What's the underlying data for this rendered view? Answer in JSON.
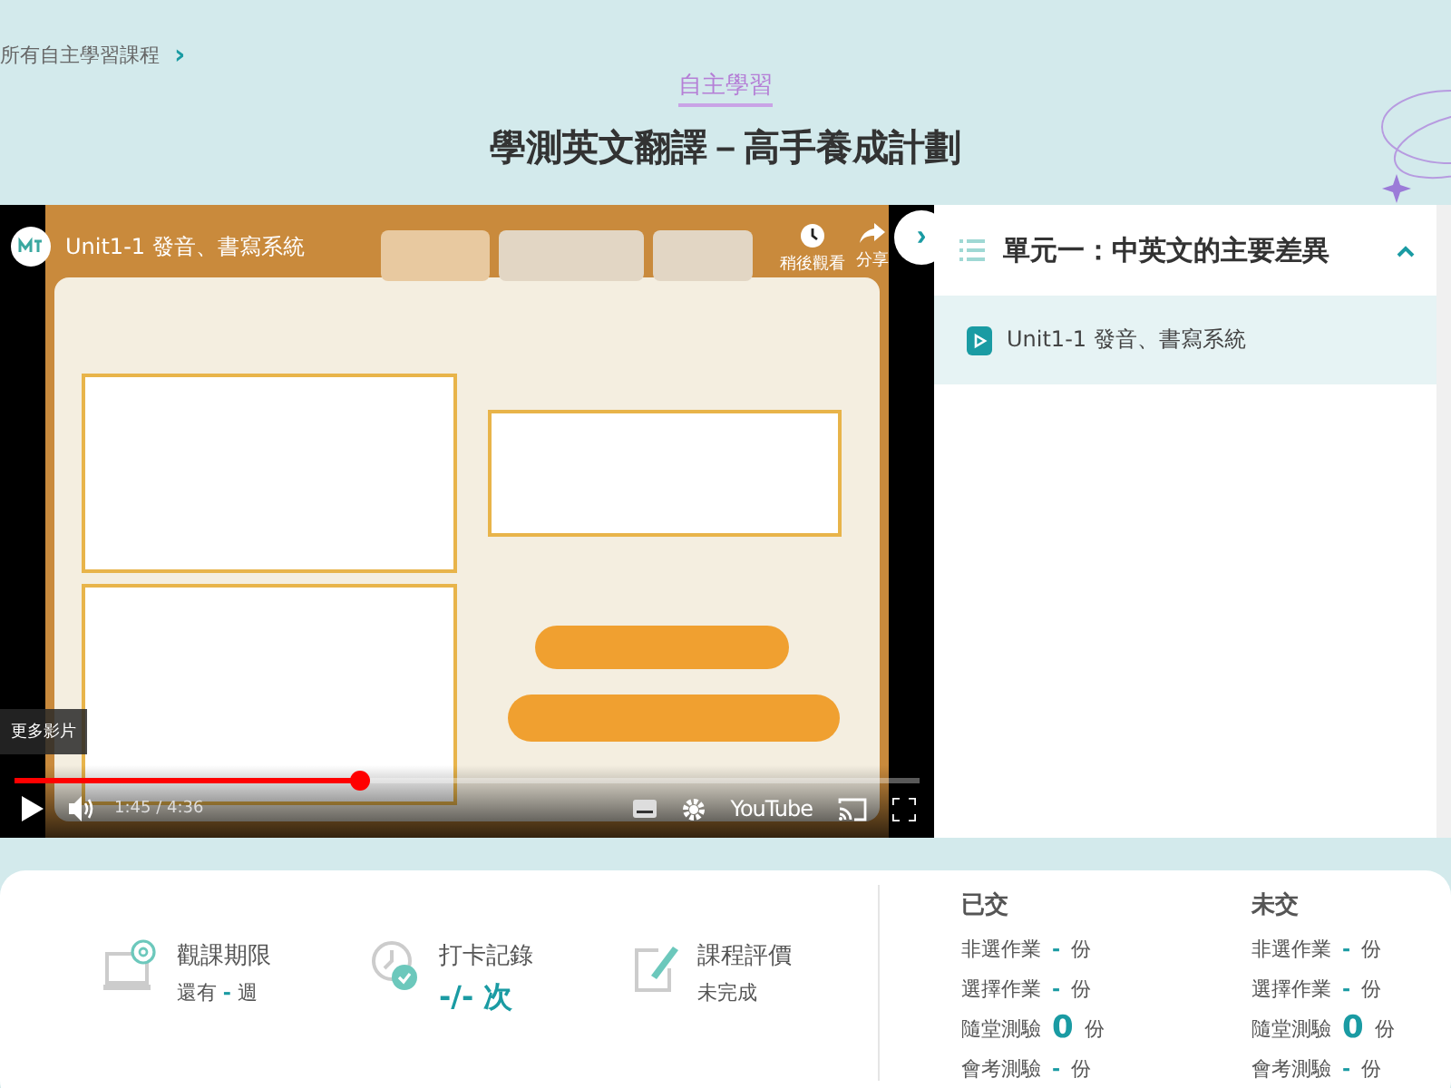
{
  "breadcrumb": {
    "label": "所有自主學習課程",
    "chevron": "›"
  },
  "category": "自主學習",
  "title": "學測英文翻譯－高手養成計劃",
  "video": {
    "kind": "picture",
    "title": "Unit1-1 發音、書寫系統",
    "watch_later": "稍後觀看",
    "share": "分享",
    "more_videos": "更多影片",
    "time": "1:45 / 4:36",
    "brand": "YouTube",
    "playing": false,
    "progress": {
      "level": 0.38
    }
  },
  "panel_toggle": "›",
  "chapter": {
    "title": "單元一：中英文的主要差異",
    "expanded": true,
    "lessons": [
      {
        "title": "Unit1-1 發音、書寫系統",
        "selected": true
      }
    ]
  },
  "stats": [
    {
      "kind": "deadline",
      "label": "觀課期限",
      "prefix": "還有",
      "value": "-",
      "suffix": "週"
    },
    {
      "kind": "checkin",
      "label": "打卡記錄",
      "value": "-/-",
      "suffix": "次"
    },
    {
      "kind": "review",
      "label": "課程評價",
      "text": "未完成"
    }
  ],
  "submissions": [
    {
      "heading": "已交",
      "rows": [
        {
          "label": "非選作業",
          "count": "-",
          "unit": "份"
        },
        {
          "label": "選擇作業",
          "count": "-",
          "unit": "份"
        },
        {
          "label": "隨堂測驗",
          "count": "0",
          "unit": "份"
        },
        {
          "label": "會考測驗",
          "count": "-",
          "unit": "份"
        }
      ]
    },
    {
      "heading": "未交",
      "rows": [
        {
          "label": "非選作業",
          "count": "-",
          "unit": "份"
        },
        {
          "label": "選擇作業",
          "count": "-",
          "unit": "份"
        },
        {
          "label": "隨堂測驗",
          "count": "0",
          "unit": "份"
        },
        {
          "label": "會考測驗",
          "count": "-",
          "unit": "份"
        }
      ]
    }
  ]
}
